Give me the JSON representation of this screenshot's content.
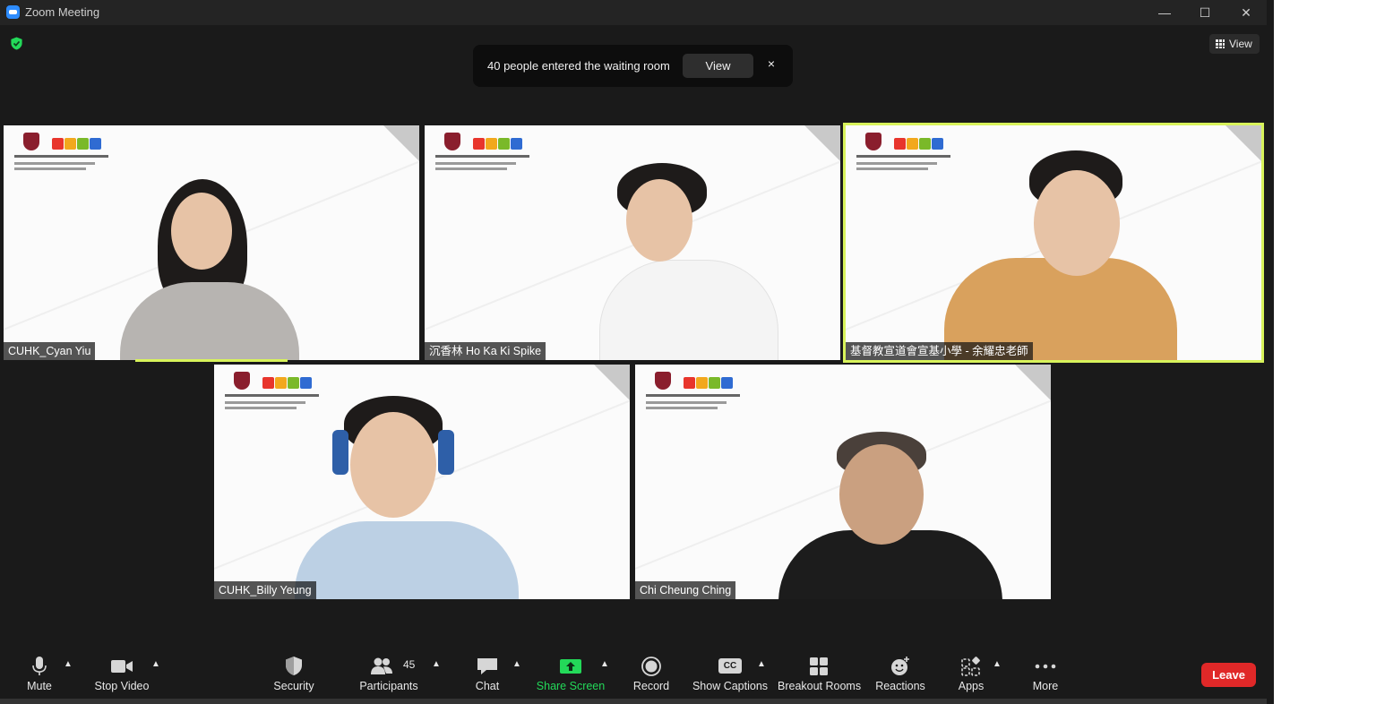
{
  "window": {
    "title": "Zoom Meeting"
  },
  "window_controls": {
    "minimize": "—",
    "maximize": "☐",
    "close": "✕"
  },
  "top": {
    "view_label": "View"
  },
  "notification": {
    "message": "40 people entered the waiting room",
    "view_label": "View",
    "close": "×"
  },
  "participants": [
    {
      "name": "CUHK_Cyan Yiu",
      "speaking": false
    },
    {
      "name": "沉香林 Ho Ka Ki Spike",
      "speaking": false
    },
    {
      "name": "基督教宣道會宣基小學 - 余耀忠老師",
      "speaking": true
    },
    {
      "name": "CUHK_Billy Yeung",
      "speaking": false
    },
    {
      "name": "Chi Cheung Ching",
      "speaking": false
    }
  ],
  "toolbar": {
    "mute": "Mute",
    "stop_video": "Stop Video",
    "security": "Security",
    "participants": "Participants",
    "participants_count": "45",
    "chat": "Chat",
    "share_screen": "Share Screen",
    "record": "Record",
    "show_captions": "Show Captions",
    "captions_icon_text": "CC",
    "breakout_rooms": "Breakout Rooms",
    "reactions": "Reactions",
    "apps": "Apps",
    "more": "More",
    "leave": "Leave"
  },
  "colors": {
    "share_green": "#23d959",
    "leave_red": "#e02828",
    "active_speaker": "#d8f35b",
    "shield_green": "#23d959"
  }
}
